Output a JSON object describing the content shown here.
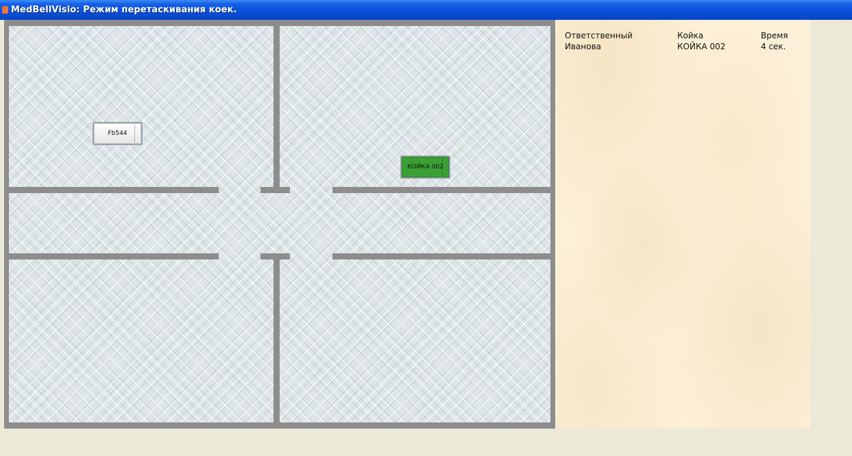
{
  "window": {
    "title": "MedBellVisio: Режим перетаскивания коек."
  },
  "floorplan": {
    "beds": [
      {
        "label": "Fb544",
        "status_color": "#e8e8e8"
      },
      {
        "label": "КОЙКА 002",
        "status_color": "#3aa034"
      }
    ]
  },
  "info": {
    "headers": {
      "responsible": "Ответственный",
      "bed": "Койка",
      "time": "Время"
    },
    "rows": [
      {
        "responsible": "Иванова",
        "bed": "КОЙКА 002",
        "time": "4 сек."
      }
    ]
  },
  "colors": {
    "titlebar": "#0a4fd8",
    "wall": "#8d8d8d",
    "panel": "#fcf0d8",
    "window_bg": "#ece9d8"
  }
}
